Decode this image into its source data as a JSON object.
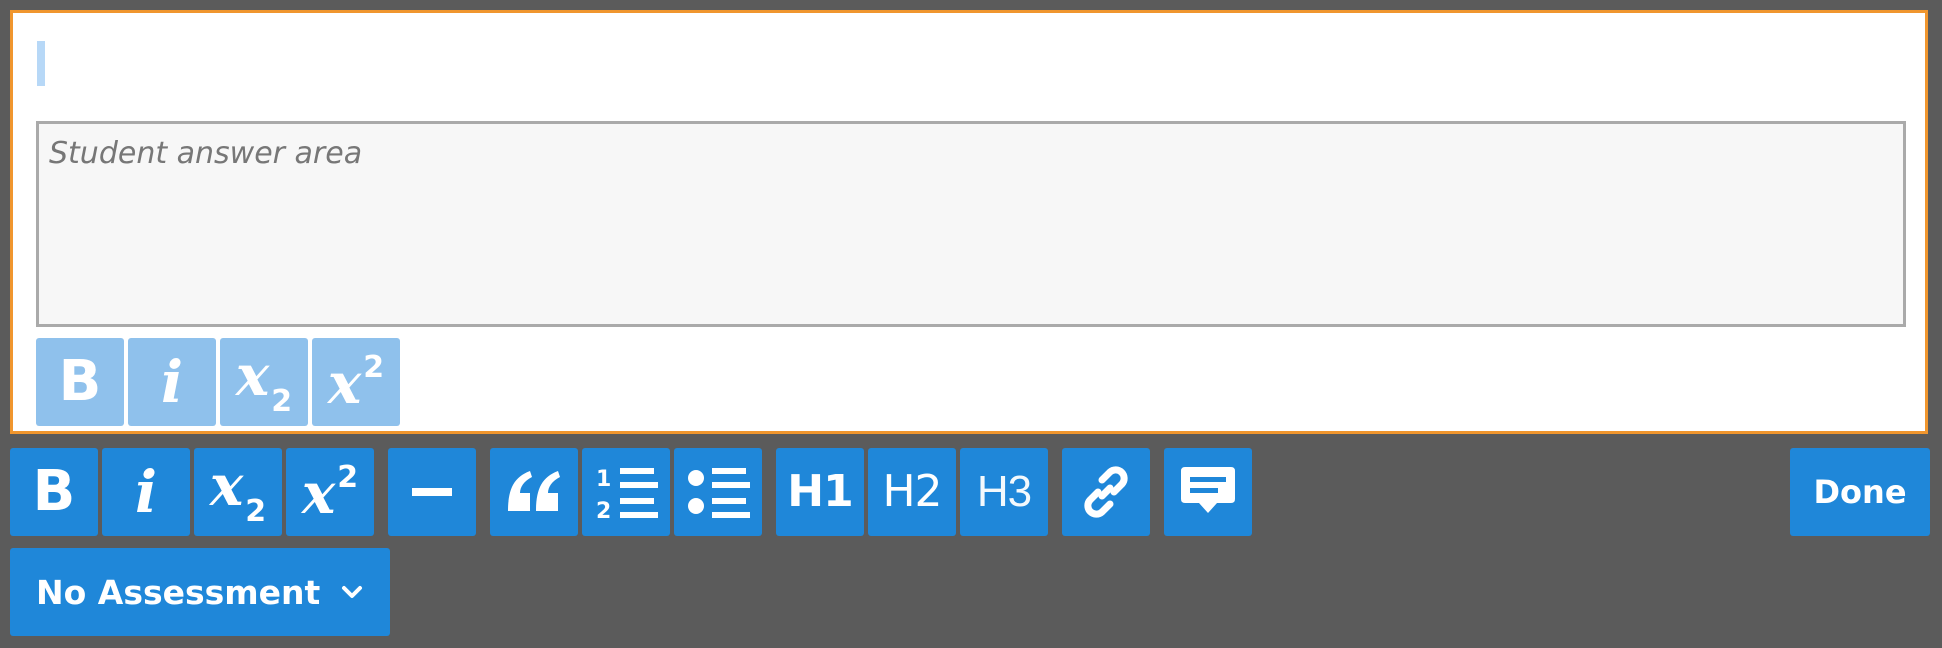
{
  "editor": {
    "answer_placeholder": "Student answer area",
    "inline_toolbar": [
      {
        "id": "bold",
        "label": "B"
      },
      {
        "id": "italic",
        "label": "i"
      },
      {
        "id": "subscript",
        "base": "x",
        "script": "2"
      },
      {
        "id": "superscript",
        "base": "x",
        "script": "2"
      }
    ]
  },
  "toolbar": {
    "bold_label": "B",
    "italic_label": "i",
    "subscript": {
      "base": "x",
      "script": "2"
    },
    "superscript": {
      "base": "x",
      "script": "2"
    },
    "ordered_list_numbers": [
      "1",
      "2"
    ],
    "heading1_label": "H1",
    "heading2_label": "H2",
    "heading3_label": "H3",
    "icons": {
      "horizontal_rule": "minus-icon",
      "blockquote": "quote-icon",
      "ordered_list": "ordered-list-icon",
      "unordered_list": "bullet-list-icon",
      "link": "link-icon",
      "comment": "comment-icon"
    },
    "done_label": "Done"
  },
  "assessment": {
    "selected": "No Assessment"
  },
  "colors": {
    "background": "#5b5b5b",
    "editor_border": "#f0962e",
    "button_blue": "#1f87d9",
    "button_light_blue": "#8fc1ec",
    "caret": "#b7d8f7",
    "answer_area_bg": "#f7f7f7",
    "answer_area_border": "#aaaaaa"
  }
}
